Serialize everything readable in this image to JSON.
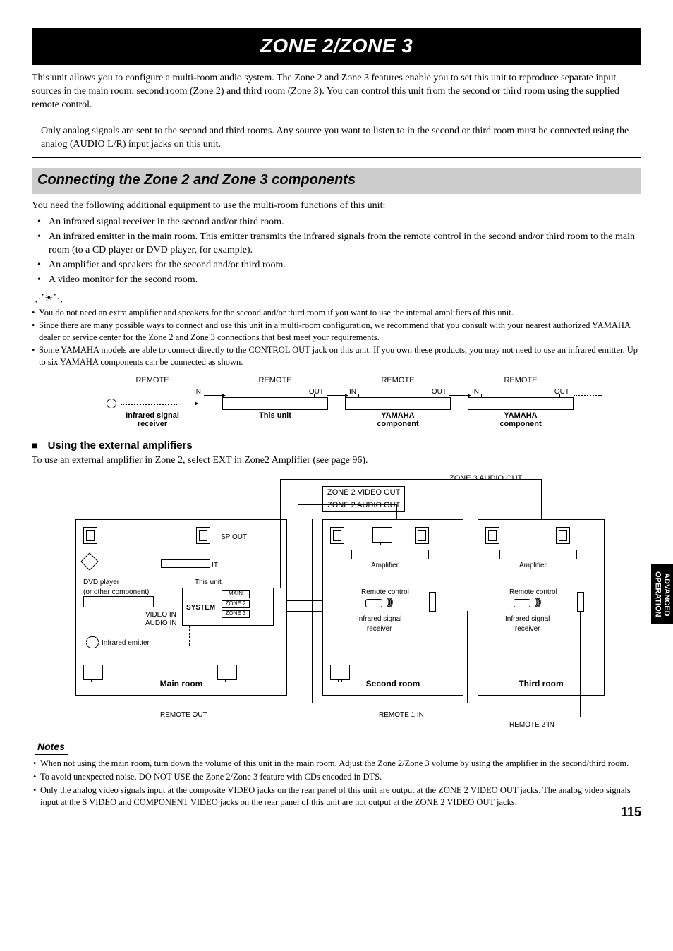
{
  "title": "ZONE 2/ZONE 3",
  "intro": "This unit allows you to configure a multi-room audio system. The Zone 2 and Zone 3 features enable you to set this unit to reproduce separate input sources in the main room, second room (Zone 2) and third room (Zone 3). You can control this unit from the second or third room using the supplied remote control.",
  "analog_note": "Only analog signals are sent to the second and third rooms. Any source you want to listen to in the second or third room must be connected using the analog (AUDIO L/R) input jacks on this unit.",
  "subhead": "Connecting the Zone 2 and Zone 3 components",
  "need_line": "You need the following additional equipment to use the multi-room functions of this unit:",
  "needs": [
    "An infrared signal receiver in the second and/or third room.",
    "An infrared emitter in the main room. This emitter transmits the infrared signals from the remote control in the second and/or third room to the main room (to a CD player or DVD player, for example).",
    "An amplifier and speakers for the second and/or third room.",
    "A video monitor for the second room."
  ],
  "tips": [
    "You do not need an extra amplifier and speakers for the second and/or third room if you want to use the internal amplifiers of this unit.",
    "Since there are many possible ways to connect and use this unit in a multi-room configuration, we recommend that you consult with your nearest authorized YAMAHA dealer or service center for the Zone 2 and Zone 3 connections that best meet your requirements.",
    "Some YAMAHA models are able to connect directly to the CONTROL OUT jack on this unit. If you own these products, you may not need to use an infrared emitter. Up to six YAMAHA components can be connected as shown."
  ],
  "chain": {
    "remote": "REMOTE",
    "in": "IN",
    "out": "OUT",
    "items": [
      "Infrared signal\nreceiver",
      "This unit",
      "YAMAHA\ncomponent",
      "YAMAHA\ncomponent"
    ]
  },
  "ext_amp_head": "Using the external amplifiers",
  "ext_amp_body": "To use an external amplifier in Zone 2, select EXT in Zone2 Amplifier (see page 96).",
  "sys": {
    "zone3_audio_out": "ZONE 3 AUDIO OUT",
    "zone2_video_out": "ZONE 2 VIDEO OUT",
    "zone2_audio_out": "ZONE 2 AUDIO OUT",
    "sp_out": "SP OUT",
    "monitor_out": "MONITOR OUT",
    "dvd": "DVD player\n(or other component)",
    "this_unit": "This unit",
    "system": "SYSTEM",
    "main": "MAIN",
    "zone2": "ZONE 2",
    "zone3": "ZONE 3",
    "video_in": "VIDEO IN",
    "audio_in": "AUDIO IN",
    "ir_emitter": "Infrared emitter",
    "amplifier": "Amplifier",
    "remote_control": "Remote control",
    "ir_receiver": "Infrared signal\nreceiver",
    "main_room": "Main room",
    "second_room": "Second room",
    "third_room": "Third room",
    "remote_out": "REMOTE OUT",
    "remote1_in": "REMOTE 1 IN",
    "remote2_in": "REMOTE 2 IN"
  },
  "notes_head": "Notes",
  "notes": [
    "When not using the main room, turn down the volume of this unit in the main room. Adjust the Zone 2/Zone 3 volume by using the amplifier in the second/third room.",
    "To avoid unexpected noise, DO NOT USE the Zone 2/Zone 3 feature with CDs encoded in DTS.",
    "Only the analog video signals input at the composite VIDEO jacks on the rear panel of this unit are output at the ZONE 2 VIDEO OUT jacks. The analog video signals input at the S VIDEO and COMPONENT VIDEO jacks on the rear panel of this unit are not output at the ZONE 2 VIDEO OUT jacks."
  ],
  "side_tab": "ADVANCED\nOPERATION",
  "page": "115"
}
